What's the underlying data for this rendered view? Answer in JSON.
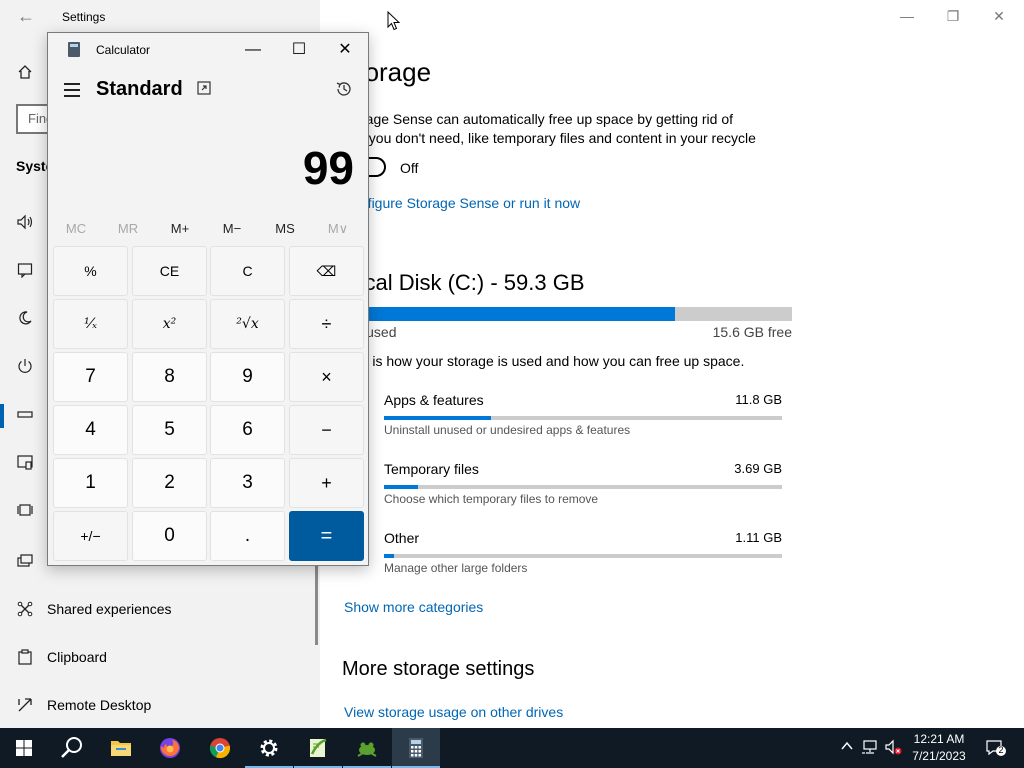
{
  "settings": {
    "window_title": "Settings",
    "search_placeholder": "Find",
    "section_label": "Syste",
    "nav_items": [
      {
        "label": "Projecting to this PC",
        "icon": "projector-icon"
      },
      {
        "label": "Shared experiences",
        "icon": "shared-experiences-icon"
      },
      {
        "label": "Clipboard",
        "icon": "clipboard-icon"
      },
      {
        "label": "Remote Desktop",
        "icon": "remote-desktop-icon"
      }
    ],
    "main": {
      "title": "Storage",
      "description": "Storage Sense can automatically free up space by getting rid of files you don't need, like temporary files and content in your recycle bin.",
      "toggle_state": "Off",
      "configure_link": "Configure Storage Sense or run it now",
      "disk_title": "Local Disk (C:) - 59.3 GB",
      "disk_used_fraction": 0.74,
      "disk_used_label": "GB used",
      "disk_free_label": "15.6 GB free",
      "usage_description": "This is how your storage is used and how you can free up space.",
      "categories": [
        {
          "name": "Apps & features",
          "size": "11.8 GB",
          "description": "Uninstall unused or undesired apps & features",
          "fraction": 0.27
        },
        {
          "name": "Temporary files",
          "size": "3.69 GB",
          "description": "Choose which temporary files to remove",
          "fraction": 0.085
        },
        {
          "name": "Other",
          "size": "1.11 GB",
          "description": "Manage other large folders",
          "fraction": 0.025
        }
      ],
      "show_more_link": "Show more categories",
      "more_storage_title": "More storage settings",
      "view_usage_link": "View storage usage on other drives"
    }
  },
  "calculator": {
    "window_title": "Calculator",
    "mode": "Standard",
    "display": "99",
    "memory_buttons": [
      {
        "label": "MC",
        "enabled": false
      },
      {
        "label": "MR",
        "enabled": false
      },
      {
        "label": "M+",
        "enabled": true
      },
      {
        "label": "M−",
        "enabled": true
      },
      {
        "label": "MS",
        "enabled": true
      },
      {
        "label": "M∨",
        "enabled": false
      }
    ],
    "keys": [
      [
        "%",
        "CE",
        "C",
        "⌫"
      ],
      [
        "¹⁄ₓ",
        "x²",
        "²√x",
        "÷"
      ],
      [
        "7",
        "8",
        "9",
        "×"
      ],
      [
        "4",
        "5",
        "6",
        "−"
      ],
      [
        "1",
        "2",
        "3",
        "+"
      ],
      [
        "+/−",
        "0",
        ".",
        "="
      ]
    ]
  },
  "taskbar": {
    "clock_time": "12:21 AM",
    "clock_date": "7/21/2023",
    "notification_count": "2",
    "pinned": [
      "start",
      "search",
      "file-explorer",
      "firefox",
      "chrome",
      "settings",
      "notepad-plus-plus",
      "frog-app",
      "calculator"
    ]
  },
  "colors": {
    "accent": "#0078d7",
    "link": "#0066b4",
    "equals_key": "#005a9e",
    "taskbar": "#0f1a24"
  }
}
